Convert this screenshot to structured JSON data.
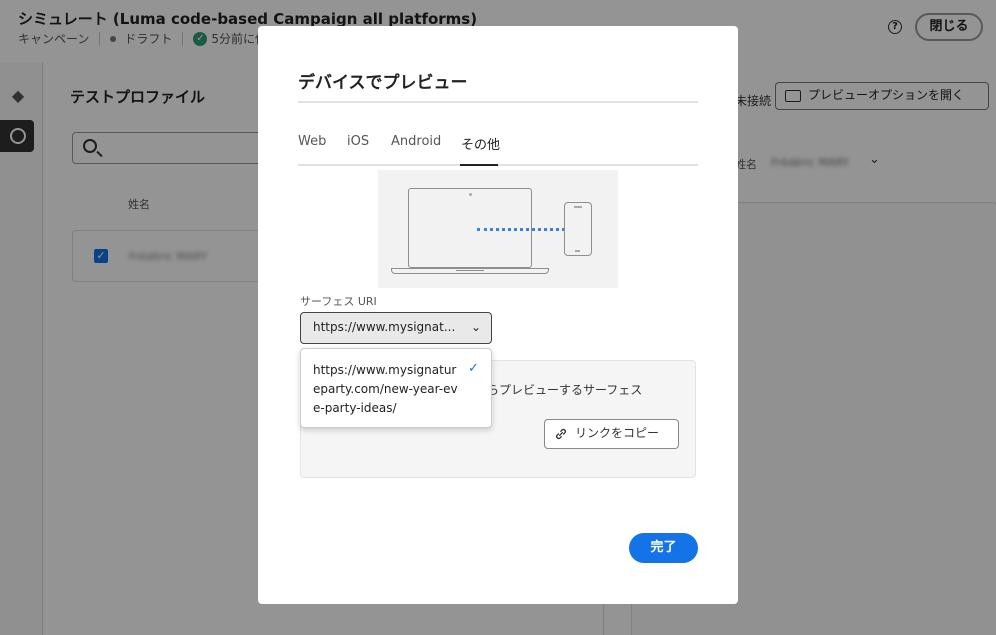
{
  "app": {
    "title": "シミュレート (Luma code-based Campaign all platforms)",
    "breadcrumb_type": "キャンペーン",
    "status": "ドラフト",
    "saved": "5分前に保存",
    "close_label": "閉じる",
    "help_icon": "?"
  },
  "left_panel": {
    "title": "テストプロファイル",
    "column_name": "姓名",
    "rows": [
      {
        "name": "Frédéric MARY",
        "checked": true
      }
    ]
  },
  "right_panel": {
    "connection_status": "未接続",
    "open_options_label": "プレビューオプションを開く",
    "name_label": "姓名",
    "name_value": "Frédéric MARY"
  },
  "modal": {
    "title": "デバイスでプレビュー",
    "tabs": [
      {
        "label": "Web",
        "active": false
      },
      {
        "label": "iOS",
        "active": false
      },
      {
        "label": "Android",
        "active": false
      },
      {
        "label": "その他",
        "active": true
      }
    ],
    "surface_uri_label": "サーフェス URI",
    "surface_uri_selected": "https://www.mysignat...",
    "dropdown_option": "https://www.mysignatureparty.com/new-year-eve-party-ideas/",
    "info_text": "らプレビューするサーフェス",
    "copy_link_label": "リンクをコピー",
    "done_label": "完了"
  },
  "colors": {
    "accent": "#1473e6",
    "overlay": "rgba(0,0,0,0.42)",
    "success": "#2d9d78"
  }
}
